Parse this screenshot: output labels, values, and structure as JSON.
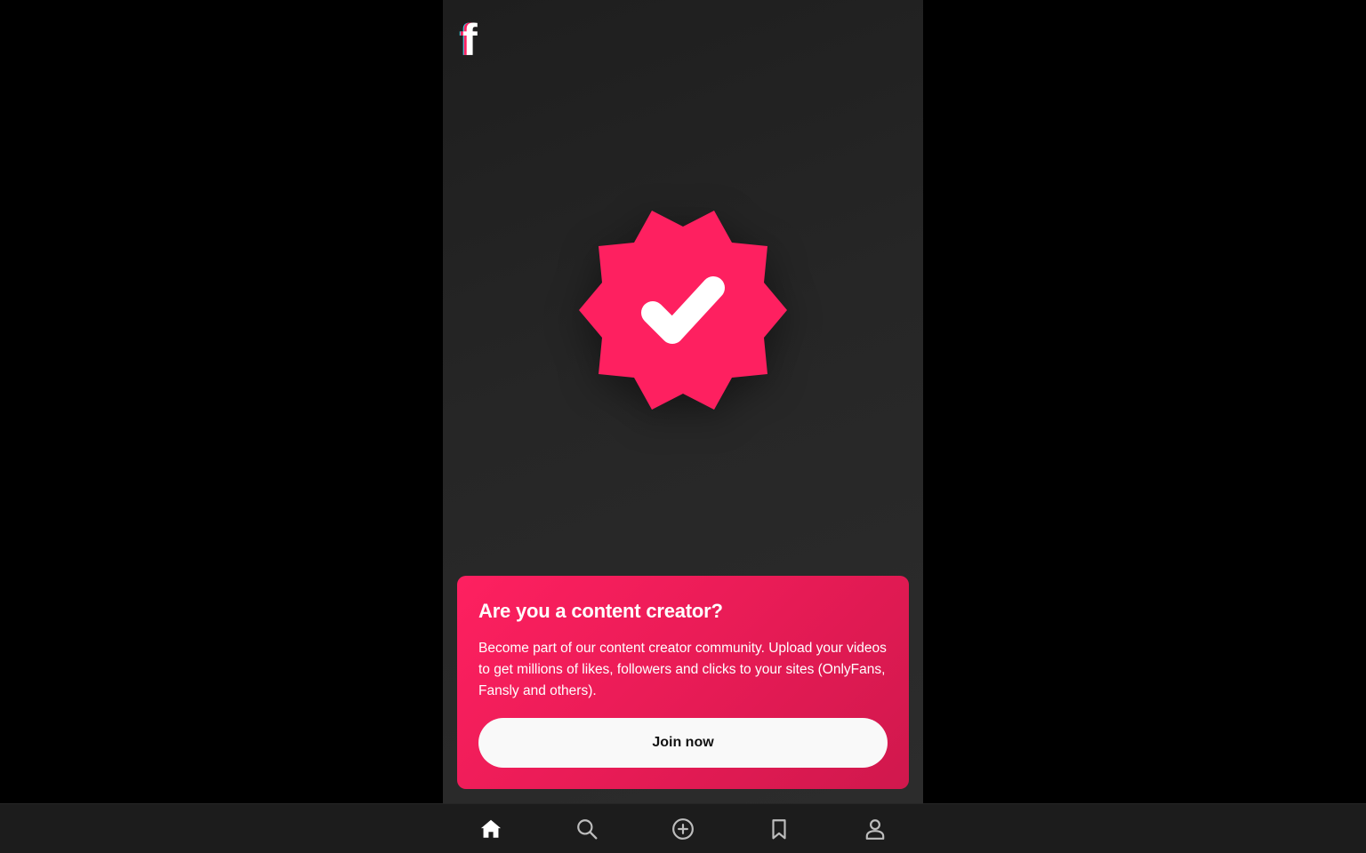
{
  "app": {
    "logo_icon": "brand-f-logo-icon",
    "brand_colors": {
      "pink": "#fe2060",
      "cyan": "#2fe0f0",
      "white": "#ffffff"
    }
  },
  "hero": {
    "icon": "verified-badge-icon",
    "badge_color": "#fe2060"
  },
  "promo": {
    "title": "Are you a content creator?",
    "description": "Become part of our content creator community. Upload your videos to get millions of likes, followers and clicks to your sites (OnlyFans, Fansly and others).",
    "button_label": "Join now"
  },
  "bottom_nav": {
    "items": [
      {
        "name": "home",
        "icon": "home-icon",
        "active": true
      },
      {
        "name": "search",
        "icon": "search-icon",
        "active": false
      },
      {
        "name": "create",
        "icon": "plus-circle-icon",
        "active": false
      },
      {
        "name": "saved",
        "icon": "bookmark-icon",
        "active": false
      },
      {
        "name": "profile",
        "icon": "user-icon",
        "active": false
      }
    ]
  }
}
